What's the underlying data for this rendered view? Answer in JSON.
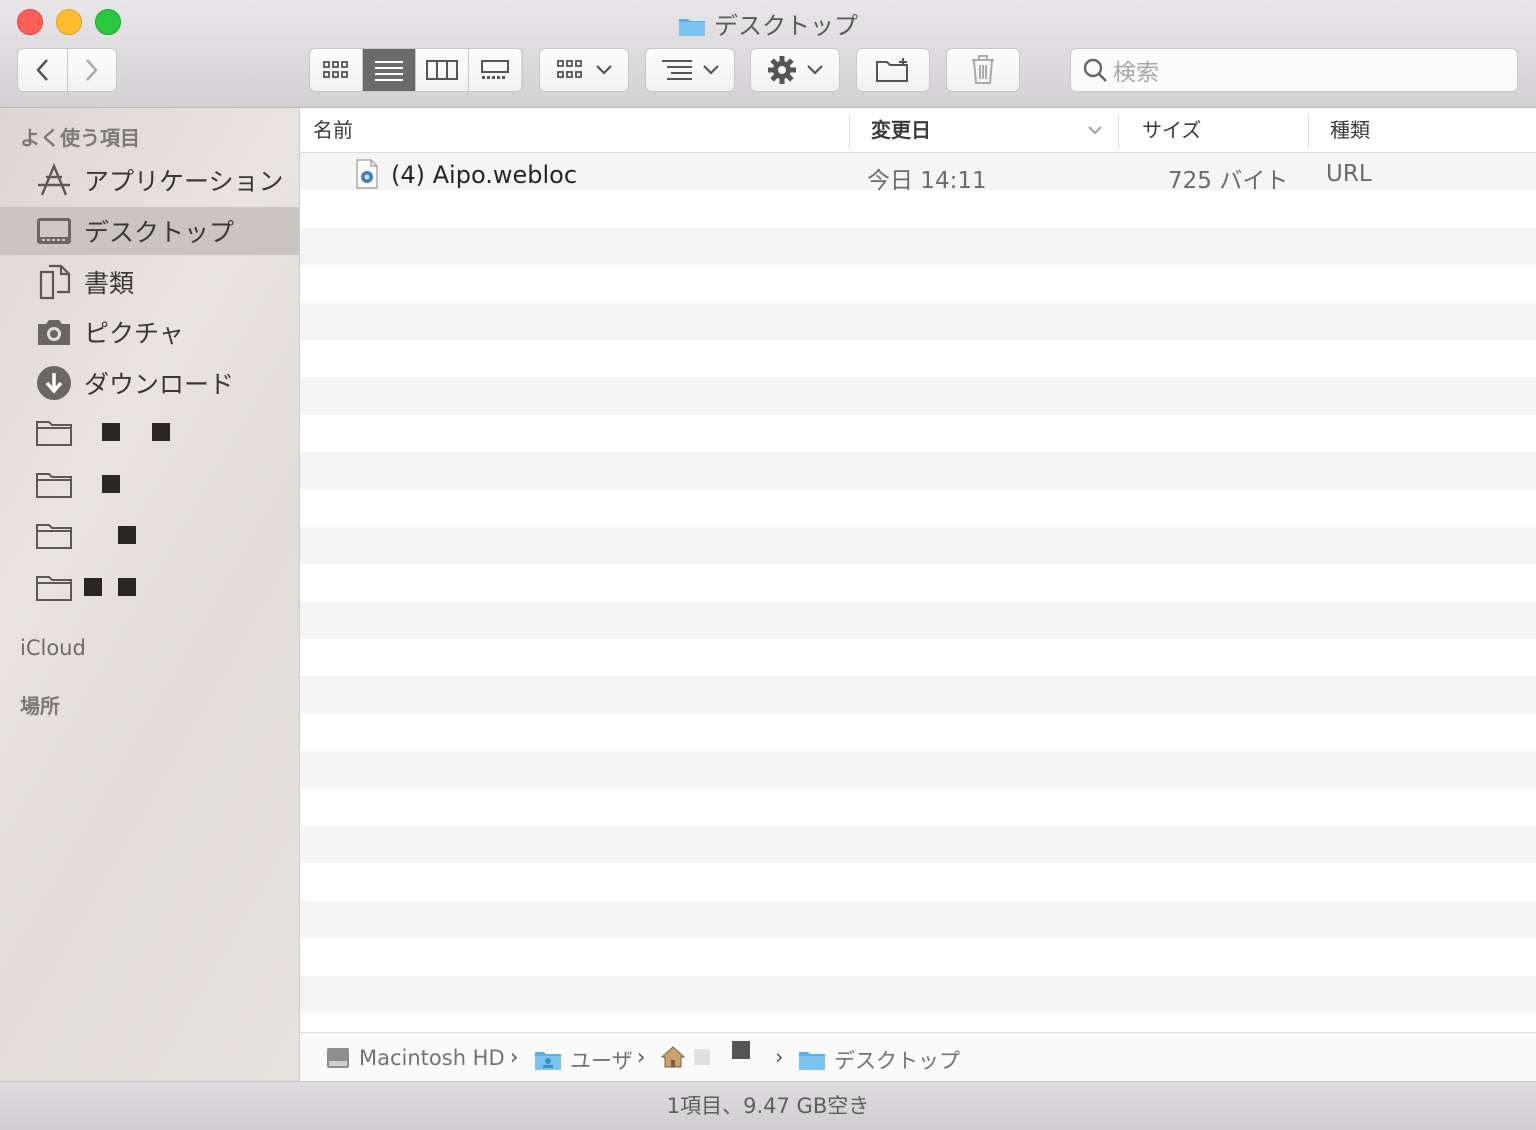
{
  "window": {
    "title": "デスクトップ"
  },
  "toolbar": {
    "search_placeholder": "検索",
    "view_modes": [
      "icon-view",
      "list-view",
      "column-view",
      "gallery-view"
    ],
    "active_view": "list-view"
  },
  "sidebar": {
    "favorites_heading": "よく使う項目",
    "items": [
      {
        "label": "アプリケーション",
        "icon": "applications-icon"
      },
      {
        "label": "デスクトップ",
        "icon": "desktop-icon",
        "selected": true
      },
      {
        "label": "書類",
        "icon": "documents-icon"
      },
      {
        "label": "ピクチャ",
        "icon": "camera-icon"
      },
      {
        "label": "ダウンロード",
        "icon": "download-icon"
      }
    ],
    "redacted_folders": 4,
    "icloud_heading": "iCloud",
    "locations_heading": "場所"
  },
  "columns": {
    "name": "名前",
    "modified": "変更日",
    "size": "サイズ",
    "kind": "種類"
  },
  "files": [
    {
      "name": "(4) Aipo.webloc",
      "modified": "今日 14:11",
      "size": "725 バイト",
      "kind": "URL"
    }
  ],
  "pathbar": {
    "disk": "Macintosh HD",
    "users": "ユーザ",
    "current": "デスクトップ"
  },
  "status": {
    "text": "1項目、9.47 GB空き"
  },
  "colors": {
    "close": "#fd5f57",
    "minimize": "#febc2e",
    "maximize": "#28c840",
    "folder_blue": "#5ab0e8"
  }
}
